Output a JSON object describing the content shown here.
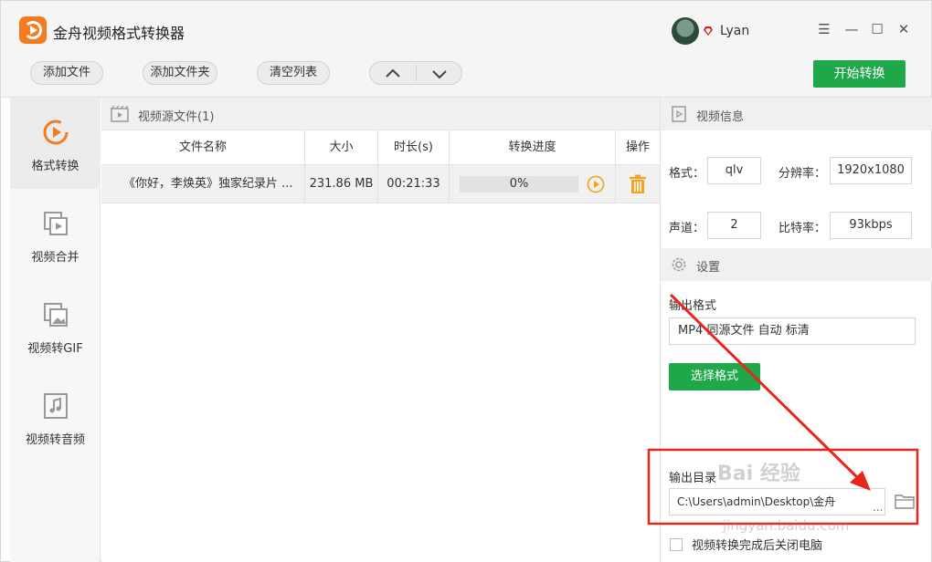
{
  "app": {
    "title": "金舟视频格式转换器",
    "username": "Lyan"
  },
  "window_controls": {
    "menu": "☰",
    "minimize": "—",
    "maximize": "☐",
    "close": "✕"
  },
  "toolbar": {
    "add_file": "添加文件",
    "add_folder": "添加文件夹",
    "clear_list": "清空列表",
    "start_convert": "开始转换"
  },
  "nav": {
    "items": [
      {
        "label": "格式转换",
        "icon": "format-convert-icon"
      },
      {
        "label": "视频合并",
        "icon": "video-merge-icon"
      },
      {
        "label": "视频转GIF",
        "icon": "video-to-gif-icon"
      },
      {
        "label": "视频转音频",
        "icon": "video-to-audio-icon"
      }
    ]
  },
  "filelist": {
    "header": "视频源文件(1)",
    "columns": [
      "文件名称",
      "大小",
      "时长(s)",
      "转换进度",
      "操作"
    ],
    "rows": [
      {
        "name": "《你好，李焕英》独家纪录片 ...",
        "size": "231.86 MB",
        "duration": "00:21:33",
        "progress_text": "0%",
        "progress": 0
      }
    ]
  },
  "video_info": {
    "header": "视频信息",
    "format_label": "格式：",
    "format": "qlv",
    "resolution_label": "分辨率：",
    "resolution": "1920x1080",
    "channel_label": "声道：",
    "channel": "2",
    "bitrate_label": "比特率：",
    "bitrate": "93kbps"
  },
  "settings": {
    "header": "设置",
    "output_format_label": "输出格式",
    "output_format": "MP4 同源文件 自动 标清",
    "select_format": "选择格式",
    "output_dir_label": "输出目录",
    "output_dir": "C:\\Users\\admin\\Desktop\\金舟",
    "dir_more": "...",
    "shutdown_label": "视频转换完成后关闭电脑"
  },
  "colors": {
    "accent_green": "#1ea84a",
    "brand_orange": "#f47b20",
    "annotation_red": "#e8261c"
  },
  "watermark": {
    "text": "Bai 经验",
    "sub": "jingyan.baidu.com"
  }
}
